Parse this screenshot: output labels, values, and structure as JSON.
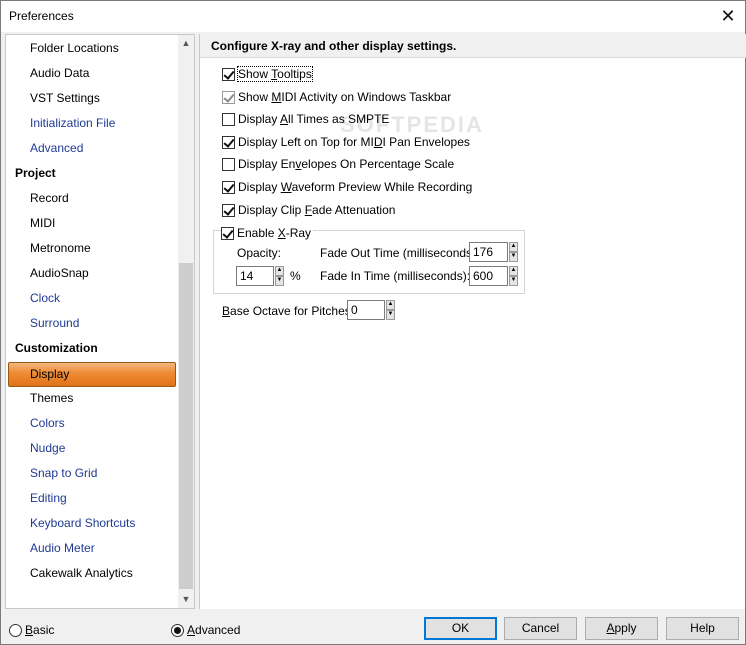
{
  "window": {
    "title": "Preferences"
  },
  "watermark": "SOFTPEDIA",
  "sidebar": {
    "items": [
      {
        "label": "Folder Locations",
        "kind": "item",
        "color": "black"
      },
      {
        "label": "Audio Data",
        "kind": "item",
        "color": "black"
      },
      {
        "label": "VST Settings",
        "kind": "item",
        "color": "black"
      },
      {
        "label": "Initialization File",
        "kind": "item",
        "color": "blue"
      },
      {
        "label": "Advanced",
        "kind": "item",
        "color": "blue"
      },
      {
        "label": "Project",
        "kind": "header"
      },
      {
        "label": "Record",
        "kind": "item",
        "color": "black"
      },
      {
        "label": "MIDI",
        "kind": "item",
        "color": "black"
      },
      {
        "label": "Metronome",
        "kind": "item",
        "color": "black"
      },
      {
        "label": "AudioSnap",
        "kind": "item",
        "color": "black"
      },
      {
        "label": "Clock",
        "kind": "item",
        "color": "blue"
      },
      {
        "label": "Surround",
        "kind": "item",
        "color": "blue"
      },
      {
        "label": "Customization",
        "kind": "header"
      },
      {
        "label": "Display",
        "kind": "selected"
      },
      {
        "label": "Themes",
        "kind": "item",
        "color": "black"
      },
      {
        "label": "Colors",
        "kind": "item",
        "color": "blue"
      },
      {
        "label": "Nudge",
        "kind": "item",
        "color": "blue"
      },
      {
        "label": "Snap to Grid",
        "kind": "item",
        "color": "blue"
      },
      {
        "label": "Editing",
        "kind": "item",
        "color": "blue"
      },
      {
        "label": "Keyboard Shortcuts",
        "kind": "item",
        "color": "blue"
      },
      {
        "label": "Audio Meter",
        "kind": "item",
        "color": "blue"
      },
      {
        "label": "Cakewalk Analytics",
        "kind": "item",
        "color": "black"
      }
    ],
    "link_color": "#1f3a93",
    "selected_color": "#ee8a33"
  },
  "main": {
    "heading": "Configure X-ray and other display settings.",
    "checkboxes": {
      "show_tooltips": {
        "pre": "Show ",
        "u": "T",
        "post": "ooltips",
        "checked": true,
        "disabled": false
      },
      "midi_activity": {
        "pre": "Show ",
        "u": "M",
        "post": "IDI Activity on Windows Taskbar",
        "checked": true,
        "disabled": true
      },
      "smpte": {
        "pre": "Display ",
        "u": "A",
        "post": "ll Times as SMPTE",
        "checked": false,
        "disabled": false
      },
      "left_on_top": {
        "pre": "Display Left on Top for MI",
        "u": "D",
        "post": "I Pan Envelopes",
        "checked": true,
        "disabled": false
      },
      "percentage_scale": {
        "pre": "Display En",
        "u": "v",
        "post": "elopes On Percentage Scale",
        "checked": false,
        "disabled": false
      },
      "waveform_preview": {
        "pre": "Display ",
        "u": "W",
        "post": "aveform Preview While Recording",
        "checked": true,
        "disabled": false
      },
      "clip_fade": {
        "pre": "Display Clip ",
        "u": "F",
        "post": "ade Attenuation",
        "checked": true,
        "disabled": false
      },
      "xray": {
        "pre": "Enable ",
        "u": "X",
        "post": "-Ray",
        "checked": true,
        "disabled": false
      }
    },
    "xray": {
      "opacity_label": "Opacity:",
      "opacity_value": "14",
      "percent": "%",
      "fade_out_label": "Fade Out Time (milliseconds):",
      "fade_out_value": "176",
      "fade_in_label": "Fade In Time (milliseconds):",
      "fade_in_value": "600"
    },
    "base_octave": {
      "u": "B",
      "post": "ase Octave for Pitches:",
      "value": "0"
    }
  },
  "footer": {
    "basic_pre": "",
    "basic_u": "B",
    "basic_post": "asic",
    "basic_checked": false,
    "advanced_pre": "",
    "advanced_u": "A",
    "advanced_post": "dvanced",
    "advanced_checked": true,
    "ok": "OK",
    "cancel": "Cancel",
    "apply_u": "A",
    "apply_post": "pply",
    "help": "Help"
  }
}
